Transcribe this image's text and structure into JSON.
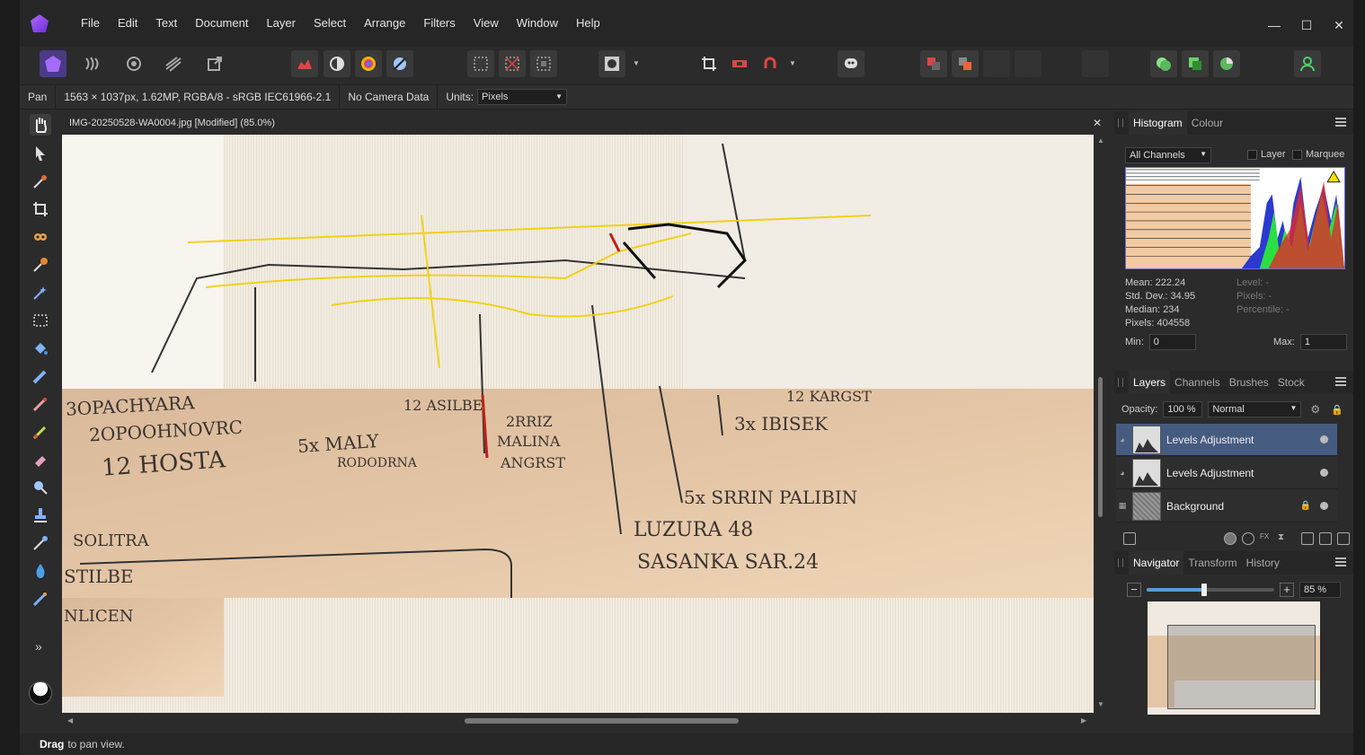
{
  "app": {
    "menus": [
      "File",
      "Edit",
      "Text",
      "Document",
      "Layer",
      "Select",
      "Arrange",
      "Filters",
      "View",
      "Window",
      "Help"
    ],
    "window_controls": [
      "—",
      "☐",
      "✕"
    ]
  },
  "context_bar": {
    "tool": "Pan",
    "image_info": "1563 × 1037px, 1.62MP, RGBA/8 - sRGB IEC61966-2.1",
    "camera": "No Camera Data",
    "units_label": "Units:",
    "units_value": "Pixels"
  },
  "document": {
    "title": "IMG-20250528-WA0004.jpg [Modified] (85.0%)",
    "close": "✕"
  },
  "status": {
    "action": "Drag",
    "hint": "to pan view."
  },
  "histogram_panel": {
    "tabs": [
      "Histogram",
      "Colour"
    ],
    "channel": "All Channels",
    "layer_label": "Layer",
    "marquee_label": "Marquee",
    "mean": "Mean: 222.24",
    "std_dev": "Std. Dev.: 34.95",
    "median": "Median: 234",
    "pixels": "Pixels: 404558",
    "level": "Level: -",
    "pixels_right": "Pixels: -",
    "percentile": "Percentile: -",
    "min_label": "Min:",
    "min_value": "0",
    "max_label": "Max:",
    "max_value": "1"
  },
  "layers_panel": {
    "tabs": [
      "Layers",
      "Channels",
      "Brushes",
      "Stock"
    ],
    "opacity_label": "Opacity:",
    "opacity_value": "100 %",
    "blend_mode": "Normal",
    "layers": [
      {
        "name": "Levels Adjustment",
        "selected": true
      },
      {
        "name": "Levels Adjustment",
        "selected": false
      },
      {
        "name": "Background",
        "selected": false,
        "locked": true
      }
    ]
  },
  "navigator_panel": {
    "tabs": [
      "Navigator",
      "Transform",
      "History"
    ],
    "zoom_value": "85 %",
    "zoom_fraction": 0.45
  },
  "photo_text": {
    "lines": [
      "3OPACHYARA",
      "2OPOOHNOVRC",
      "12 HOSTA",
      "5x MALY",
      "RODODRNA",
      "12 ASILBE",
      "2RRIZ",
      "MALINA",
      "ANGRST",
      "12 KARGST",
      "3x IBISEK",
      "5x SRRIN PALIBIN",
      "LUZURA 48",
      "SASANKA SAR.24",
      "SOLITRA",
      "STILBE",
      "NLICEN"
    ]
  }
}
